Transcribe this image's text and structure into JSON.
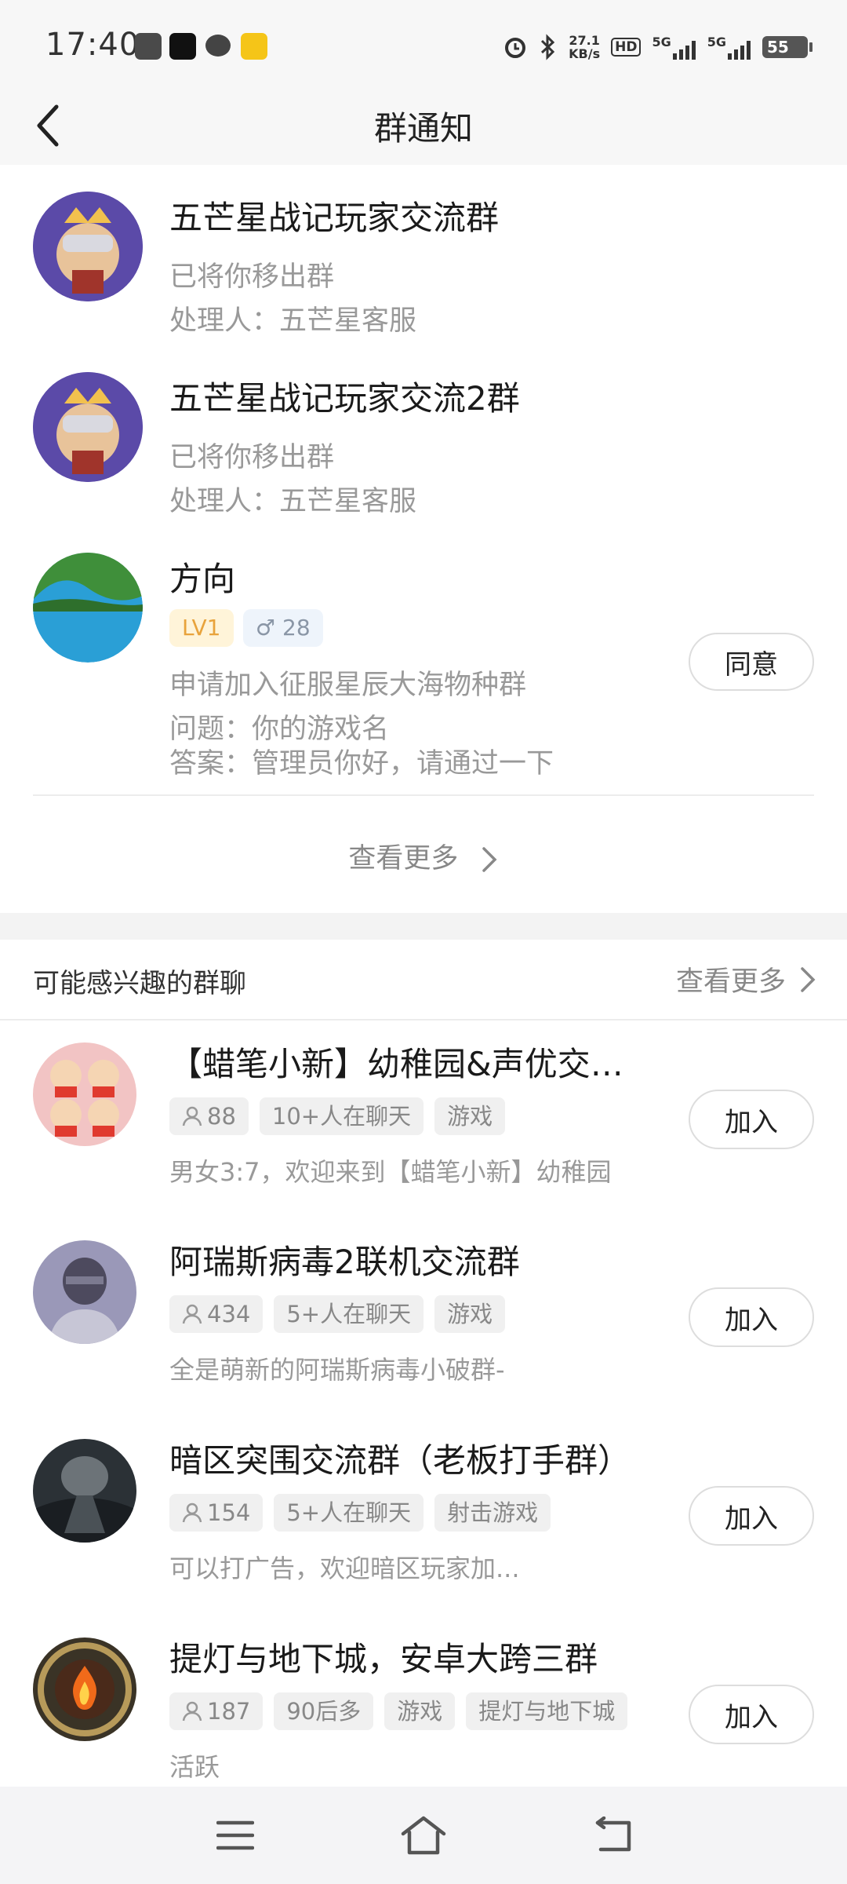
{
  "status_bar": {
    "time": "17:40",
    "speed_value": "27.1",
    "speed_unit": "KB/s",
    "hd_badge": "HD",
    "net1": "5G",
    "net2": "5G",
    "battery": "55",
    "icons": [
      "box-app-icon",
      "tiktok-icon",
      "chat-icon",
      "mail-icon",
      "alarm-icon",
      "bluetooth-icon",
      "signal-icon",
      "signal-icon"
    ]
  },
  "header": {
    "title": "群通知",
    "back_icon": "chevron-left-icon"
  },
  "notices": [
    {
      "title": "五芒星战记玩家交流群",
      "status": "已将你移出群",
      "handler": "处理人：五芒星客服"
    },
    {
      "title": "五芒星战记玩家交流2群",
      "status": "已将你移出群",
      "handler": "处理人：五芒星客服"
    },
    {
      "title": "方向",
      "level": "LV1",
      "gender_age": "♂ 28",
      "request": "申请加入征服星辰大海物种群",
      "question": "问题：你的游戏名",
      "answer": "答案：管理员你好，请通过一下",
      "agree_label": "同意"
    }
  ],
  "notices_view_more": "查看更多",
  "suggested": {
    "title": "可能感兴趣的群聊",
    "view_more": "查看更多",
    "join_label": "加入",
    "groups": [
      {
        "title": "【蜡笔小新】幼稚园&声优交流群",
        "members": "88",
        "tags": [
          "10+人在聊天",
          "游戏"
        ],
        "desc": "男女3:7，欢迎来到【蜡笔小新】幼稚园"
      },
      {
        "title": "阿瑞斯病毒2联机交流群",
        "members": "434",
        "tags": [
          "5+人在聊天",
          "游戏"
        ],
        "desc": "全是萌新的阿瑞斯病毒小破群-"
      },
      {
        "title": "暗区突围交流群（老板打手群）",
        "members": "154",
        "tags": [
          "5+人在聊天",
          "射击游戏"
        ],
        "desc": "可以打广告，欢迎暗区玩家加..."
      },
      {
        "title": "提灯与地下城，安卓大跨三群",
        "members": "187",
        "tags": [
          "90后多",
          "游戏",
          "提灯与地下城"
        ],
        "desc": "活跃"
      }
    ]
  },
  "nav_bar": {
    "icons": [
      "menu-icon",
      "home-icon",
      "back-icon"
    ]
  },
  "colors": {
    "level_badge_bg": "#fff4d9",
    "level_badge_text": "#e8a33c",
    "gender_badge_bg": "#eef4fb",
    "gender_badge_text": "#4a90e2",
    "secondary_text": "#999999"
  }
}
